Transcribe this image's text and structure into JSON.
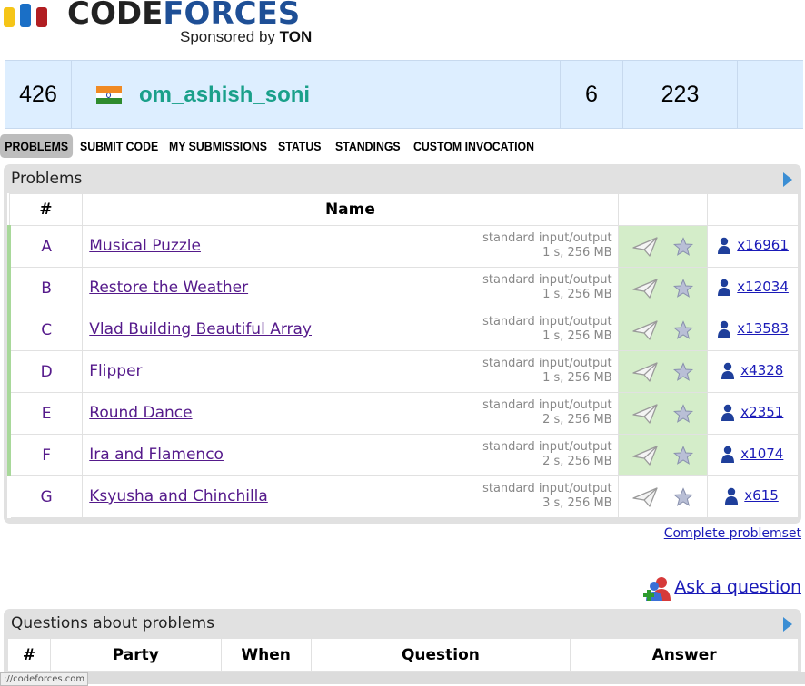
{
  "logo": {
    "word_part1": "CODE",
    "word_part2": "FORCES",
    "sponsor_prefix": "Sponsored by ",
    "sponsor_brand": "TON",
    "colors": {
      "bar1": "#f5c518",
      "bar2": "#1a6fc6",
      "bar3": "#b11e22"
    }
  },
  "standings": {
    "rank": "426",
    "handle": "om_ashish_soni",
    "solved": "6",
    "penalty": "223"
  },
  "menu": {
    "items": [
      "PROBLEMS",
      "SUBMIT CODE",
      "MY SUBMISSIONS",
      "STATUS",
      "STANDINGS",
      "CUSTOM INVOCATION"
    ],
    "active": "PROBLEMS"
  },
  "problems": {
    "title": "Problems",
    "columns": {
      "index": "#",
      "name": "Name"
    },
    "rows": [
      {
        "index": "A",
        "name": "Musical Puzzle",
        "io": "standard input/output",
        "limits": "1 s, 256 MB",
        "solved": "x16961",
        "accepted": true
      },
      {
        "index": "B",
        "name": "Restore the Weather",
        "io": "standard input/output",
        "limits": "1 s, 256 MB",
        "solved": "x12034",
        "accepted": true
      },
      {
        "index": "C",
        "name": "Vlad Building Beautiful Array",
        "io": "standard input/output",
        "limits": "1 s, 256 MB",
        "solved": "x13583",
        "accepted": true
      },
      {
        "index": "D",
        "name": "Flipper",
        "io": "standard input/output",
        "limits": "1 s, 256 MB",
        "solved": "x4328",
        "accepted": true
      },
      {
        "index": "E",
        "name": "Round Dance",
        "io": "standard input/output",
        "limits": "2 s, 256 MB",
        "solved": "x2351",
        "accepted": true
      },
      {
        "index": "F",
        "name": "Ira and Flamenco",
        "io": "standard input/output",
        "limits": "2 s, 256 MB",
        "solved": "x1074",
        "accepted": true
      },
      {
        "index": "G",
        "name": "Ksyusha and Chinchilla",
        "io": "standard input/output",
        "limits": "3 s, 256 MB",
        "solved": "x615",
        "accepted": false
      }
    ],
    "complete_link": "Complete problemset"
  },
  "ask_link": "Ask a question",
  "questions": {
    "title": "Questions about problems",
    "columns": {
      "index": "#",
      "party": "Party",
      "when": "When",
      "question": "Question",
      "answer": "Answer"
    }
  },
  "statusbar": {
    "url": "://codeforces.com"
  }
}
